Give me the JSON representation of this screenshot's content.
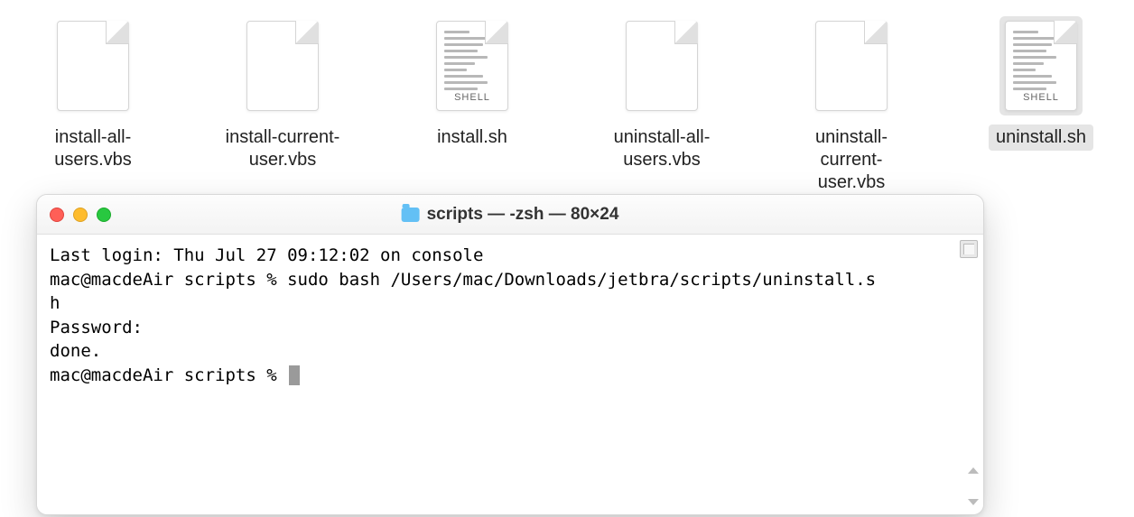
{
  "files": [
    {
      "name": "install-all-users.vbs",
      "type": "generic",
      "selected": false
    },
    {
      "name": "install-current-user.vbs",
      "type": "generic",
      "selected": false
    },
    {
      "name": "install.sh",
      "type": "shell",
      "badge": "SHELL",
      "selected": false
    },
    {
      "name": "uninstall-all-users.vbs",
      "type": "generic",
      "selected": false
    },
    {
      "name": "uninstall-current-user.vbs",
      "type": "generic",
      "selected": false
    },
    {
      "name": "uninstall.sh",
      "type": "shell",
      "badge": "SHELL",
      "selected": true
    }
  ],
  "terminal": {
    "title": "scripts — -zsh — 80×24",
    "lines": [
      "Last login: Thu Jul 27 09:12:02 on console",
      "mac@macdeAir scripts % sudo bash /Users/mac/Downloads/jetbra/scripts/uninstall.s",
      "h",
      "Password:",
      "done.",
      "mac@macdeAir scripts % "
    ]
  }
}
